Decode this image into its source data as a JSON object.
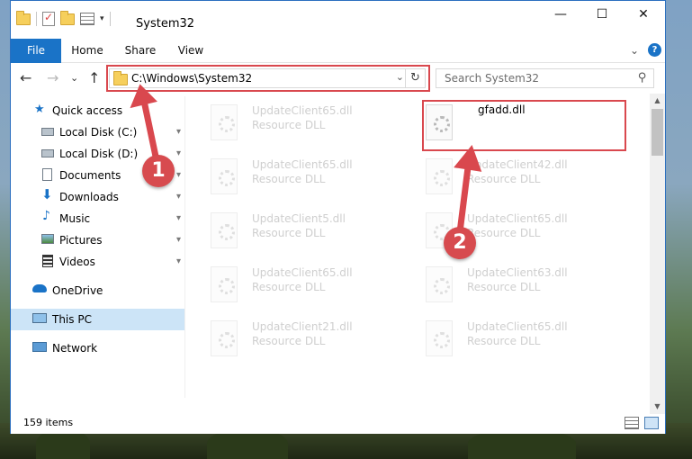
{
  "window": {
    "title": "System32",
    "controls": {
      "minimize": "—",
      "maximize": "☐",
      "close": "✕"
    }
  },
  "ribbon": {
    "tabs": [
      "File",
      "Home",
      "Share",
      "View"
    ],
    "expand": "⌄",
    "help": "?"
  },
  "nav": {
    "back": "←",
    "forward": "→",
    "recent": "⌄",
    "up": "↑",
    "address": "C:\\Windows\\System32",
    "address_dropdown": "⌄",
    "refresh": "↻",
    "search_placeholder": "Search System32",
    "search_icon": "⚲"
  },
  "sidebar": {
    "items": [
      {
        "label": "Quick access",
        "icon": "star-icon",
        "pinned": false
      },
      {
        "label": "Local Disk (C:)",
        "icon": "drive-icon",
        "pinned": true
      },
      {
        "label": "Local Disk (D:)",
        "icon": "drive-icon",
        "pinned": true
      },
      {
        "label": "Documents",
        "icon": "documents-icon",
        "pinned": true
      },
      {
        "label": "Downloads",
        "icon": "download-icon",
        "pinned": true
      },
      {
        "label": "Music",
        "icon": "music-icon",
        "pinned": true
      },
      {
        "label": "Pictures",
        "icon": "pictures-icon",
        "pinned": true
      },
      {
        "label": "Videos",
        "icon": "videos-icon",
        "pinned": true
      },
      {
        "label": "OneDrive",
        "icon": "cloud-icon",
        "pinned": false
      },
      {
        "label": "This PC",
        "icon": "computer-icon",
        "pinned": false,
        "selected": true
      },
      {
        "label": "Network",
        "icon": "network-icon",
        "pinned": false
      }
    ],
    "pin_glyph": "📌"
  },
  "files": {
    "left_column": [
      {
        "name": "UpdateClient65.dll",
        "type": "Resource DLL"
      },
      {
        "name": "UpdateClient65.dll",
        "type": "Resource DLL"
      },
      {
        "name": "UpdateClient5.dll",
        "type": "Resource DLL"
      },
      {
        "name": "UpdateClient65.dll",
        "type": "Resource DLL"
      },
      {
        "name": "UpdateClient21.dll",
        "type": "Resource DLL"
      }
    ],
    "right_column": [
      {
        "name": "gfadd.dll",
        "type": ""
      },
      {
        "name": "UpdateClient42.dll",
        "type": "Resource DLL"
      },
      {
        "name": "UpdateClient65.dll",
        "type": "Resource DLL"
      },
      {
        "name": "UpdateClient63.dll",
        "type": "Resource DLL"
      },
      {
        "name": "UpdateClient65.dll",
        "type": "Resource DLL"
      }
    ]
  },
  "status": {
    "item_count": "159 items"
  },
  "annotations": {
    "step1": "1",
    "step2": "2",
    "color": "#d9484e"
  },
  "scroll": {
    "up": "▲",
    "down": "▼"
  }
}
